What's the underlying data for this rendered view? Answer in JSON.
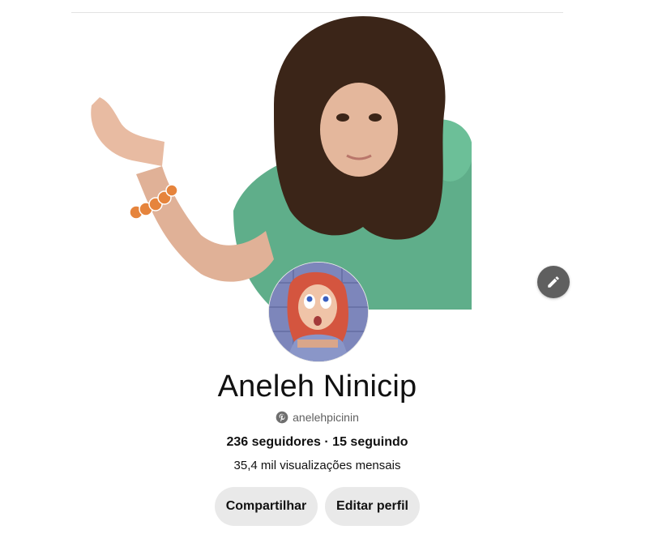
{
  "profile": {
    "name": "Aneleh Ninicip",
    "username": "anelehpicinin",
    "followers_text": "236 seguidores",
    "separator": " · ",
    "following_text": "15 seguindo",
    "monthly_views": "35,4 mil visualizações mensais"
  },
  "actions": {
    "share_label": "Compartilhar",
    "edit_profile_label": "Editar perfil"
  },
  "icons": {
    "edit_cover": "pencil-icon",
    "brand": "pinterest-logo-icon"
  },
  "colors": {
    "button_bg": "#e9e9e9",
    "edit_cover_bg": "#5f5f5f",
    "muted_text": "#5f5f5f"
  }
}
